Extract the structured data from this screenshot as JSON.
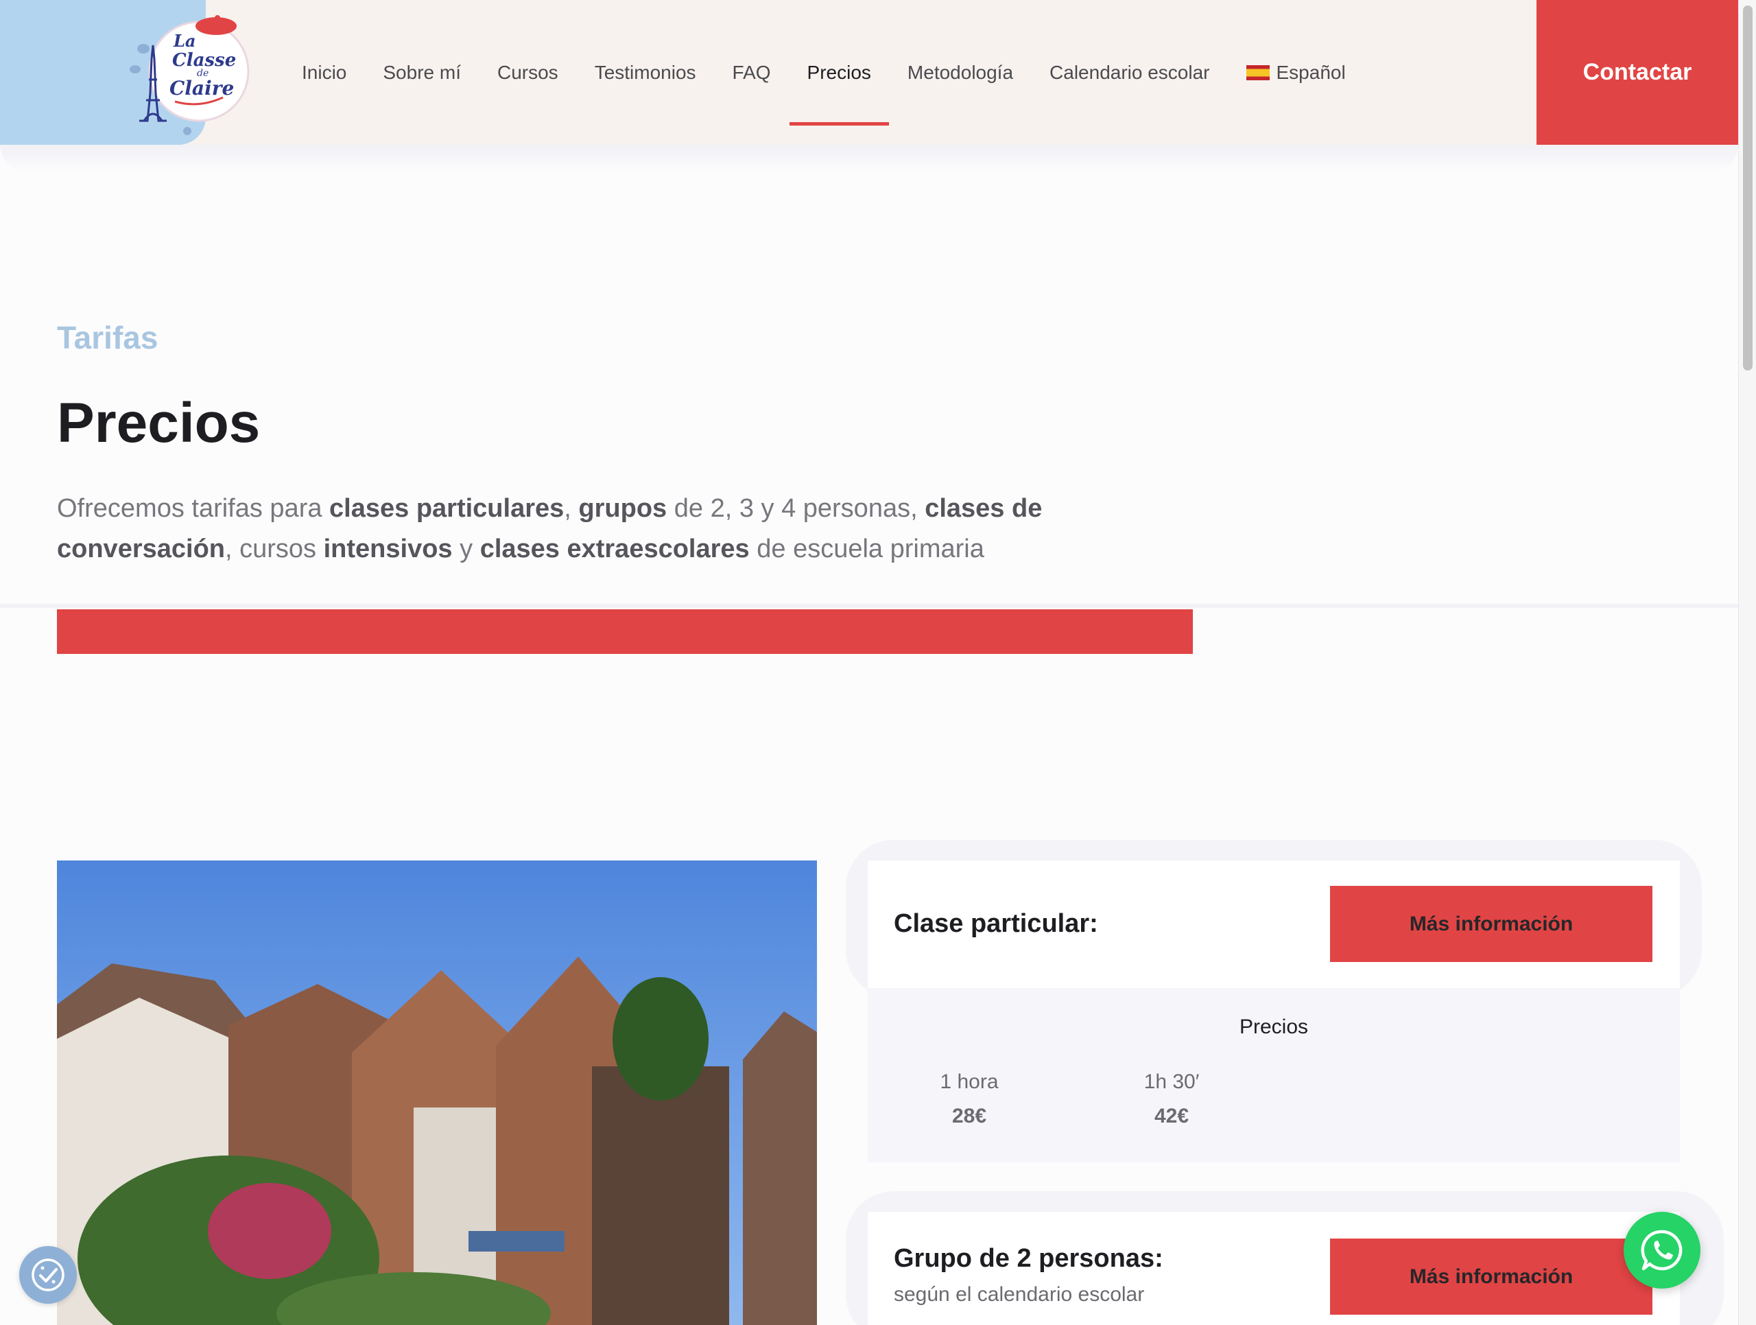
{
  "header": {
    "logo_text_line1": "La",
    "logo_text_line2": "Classe",
    "logo_text_line3": "de",
    "logo_text_line4": "Claire",
    "nav": [
      {
        "label": "Inicio"
      },
      {
        "label": "Sobre mí"
      },
      {
        "label": "Cursos"
      },
      {
        "label": "Testimonios"
      },
      {
        "label": "FAQ"
      },
      {
        "label": "Precios",
        "active": true
      },
      {
        "label": "Metodología"
      },
      {
        "label": "Calendario escolar"
      },
      {
        "label": "Español",
        "icon": "spain-flag-icon"
      }
    ],
    "contact_label": "Contactar"
  },
  "hero": {
    "kicker": "Tarifas",
    "title": "Precios",
    "intro": {
      "p1": "Ofrecemos tarifas para ",
      "b1": "clases particulares",
      "p2": ", ",
      "b2": "grupos",
      "p3": " de 2, 3 y 4 personas, ",
      "b3": "clases de conversación",
      "p4": ", cursos ",
      "b4": "intensivos",
      "p5": " y ",
      "b5": "clases extraescolares",
      "p6": " de escuela primaria"
    }
  },
  "cards": [
    {
      "title": "Clase particular:",
      "button": "Más información",
      "prices_heading": "Precios",
      "prices": [
        {
          "duration": "1 hora",
          "price": "28€"
        },
        {
          "duration": "1h 30′",
          "price": "42€"
        }
      ]
    },
    {
      "title": "Grupo de 2 personas:",
      "subtitle": "según el calendario escolar",
      "button": "Más información"
    }
  ],
  "floating": {
    "cookie_icon": "cookie-consent-icon",
    "whatsapp_icon": "whatsapp-icon"
  },
  "colors": {
    "accent_red": "#e14444",
    "header_bg": "#f8f2ee",
    "logo_bg": "#b3d4ee",
    "kicker_blue": "#a9c6e0",
    "whatsapp_green": "#25d366"
  }
}
